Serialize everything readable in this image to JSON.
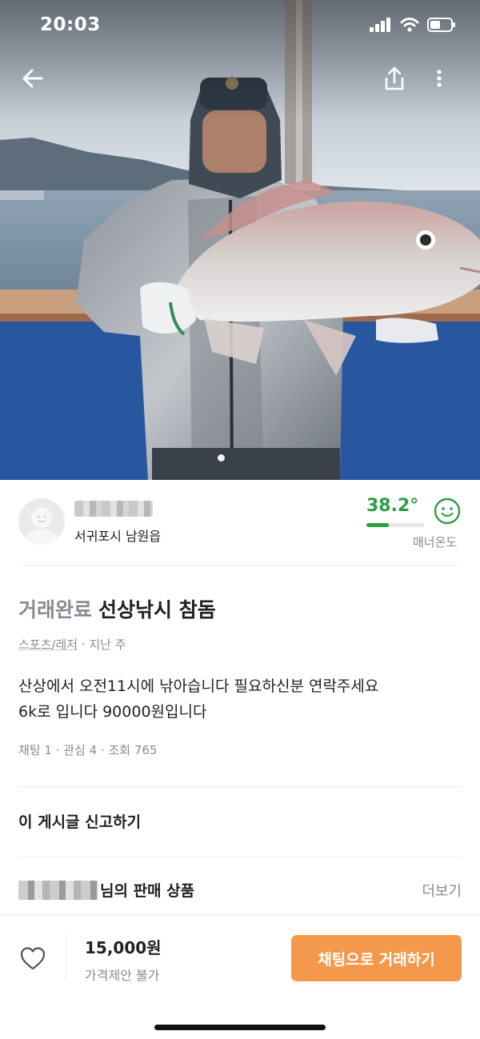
{
  "status_bar": {
    "time": "20:03"
  },
  "hero": {
    "image_alt": "Man on a boat holding a large red sea bream",
    "page_count": 1,
    "current_page": 1
  },
  "seller": {
    "region": "서귀포시 남원읍",
    "manner_temperature": "38.2°",
    "manner_temperature_value": 38.2,
    "manner_label": "매너온도",
    "temperature_color": "#2c9e45"
  },
  "article": {
    "status_label": "거래완료",
    "title": "선상낚시  참돔",
    "category": "스포츠/레저",
    "time": "지난 주",
    "body_lines": [
      "산상에서  오전11시에   낚아습니다 필요하신분  연락주세요",
      "6k로 입니다  90000원입니다"
    ],
    "chat_count": "채팅 1",
    "interest_count": "관심 4",
    "view_count": "조회 765"
  },
  "report": {
    "label": "이 게시글 신고하기"
  },
  "seller_products": {
    "title_suffix": "님의 판매 상품",
    "more_label": "더보기"
  },
  "bottom_bar": {
    "price": "15,000원",
    "negotiation": "가격제안 불가",
    "chat_button": "채팅으로 거래하기",
    "accent_color": "#f4994c"
  },
  "icons": {
    "back": "arrow-left-icon",
    "share": "share-icon",
    "more": "more-vertical-icon",
    "favorite": "heart-icon",
    "manner": "smiley-face-icon"
  }
}
